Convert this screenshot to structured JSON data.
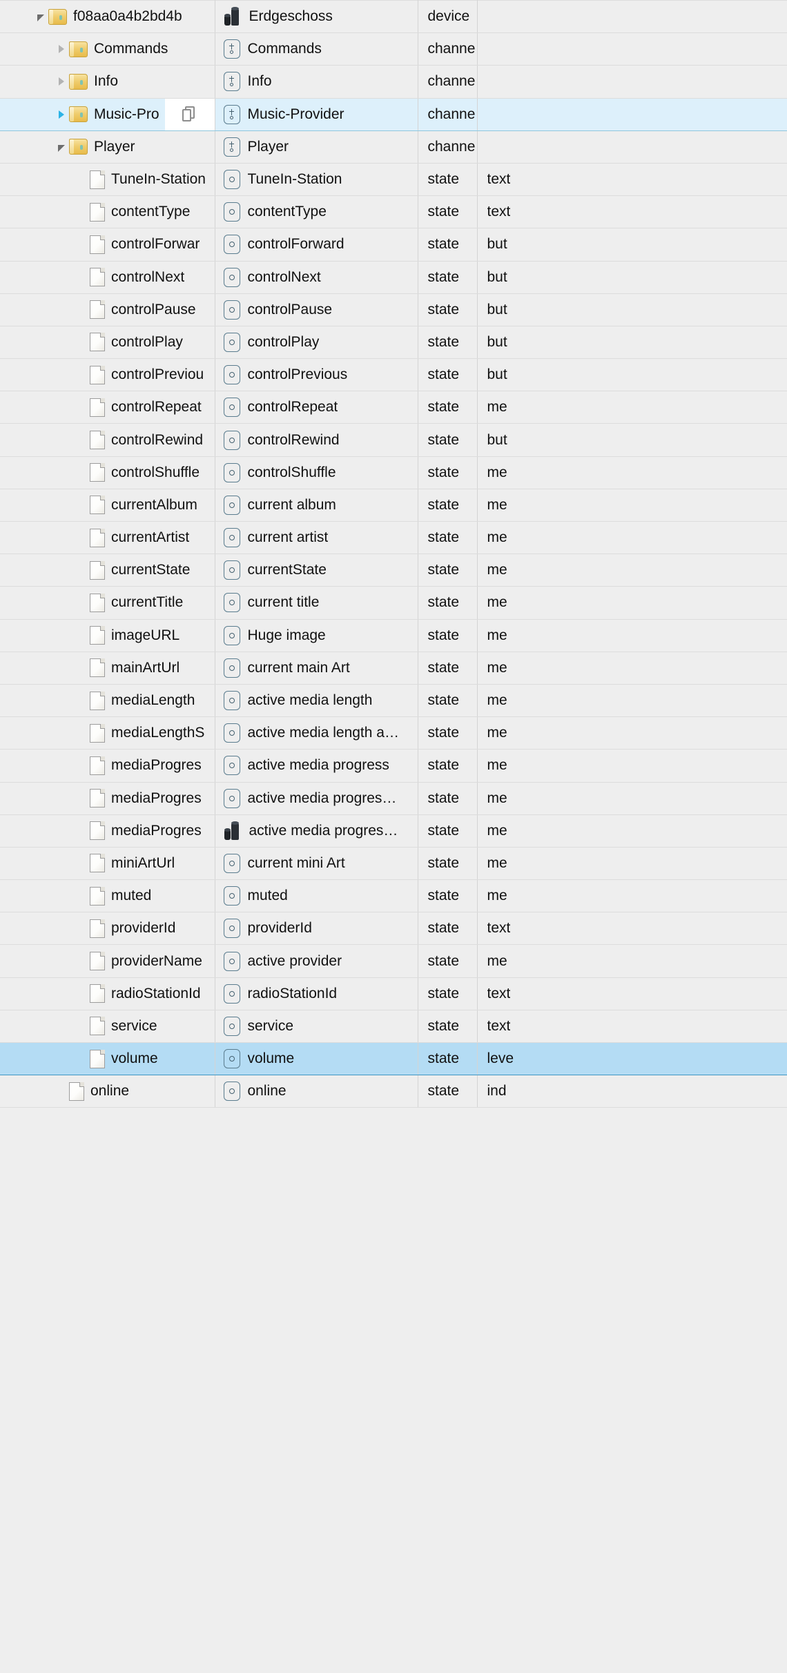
{
  "columns": [
    "name",
    "label",
    "type",
    "kind"
  ],
  "hover_action": {
    "icon": "copy-icon",
    "tooltip": "Copy"
  },
  "colors": {
    "row_background": "#eeeeee",
    "selection_light": "#ddf0fb",
    "selection_strong": "#b4dcf4",
    "selection_border": "#3f97c4",
    "grid_line": "#dcdcdc"
  },
  "rows": [
    {
      "name": "f08aa0a4b2bd4b",
      "label": "Erdgeschoss",
      "type": "device",
      "kind": "",
      "indent": 0,
      "twisty": "open",
      "icon": "folder-icon",
      "label_icon": "device-icon",
      "state": "normal"
    },
    {
      "name": "Commands",
      "label": "Commands",
      "type": "channe",
      "kind": "",
      "indent": 1,
      "twisty": "closed",
      "icon": "folder-icon",
      "label_icon": "channel-icon",
      "state": "normal"
    },
    {
      "name": "Info",
      "label": "Info",
      "type": "channe",
      "kind": "",
      "indent": 1,
      "twisty": "closed",
      "icon": "folder-icon",
      "label_icon": "channel-icon",
      "state": "normal"
    },
    {
      "name": "Music-Pro",
      "label": "Music-Provider",
      "type": "channe",
      "kind": "",
      "indent": 1,
      "twisty": "closed-blue",
      "icon": "folder-icon",
      "label_icon": "channel-icon",
      "state": "selected-light",
      "hover": true
    },
    {
      "name": "Player",
      "label": "Player",
      "type": "channe",
      "kind": "",
      "indent": 1,
      "twisty": "open",
      "icon": "folder-icon",
      "label_icon": "channel-icon",
      "state": "normal"
    },
    {
      "name": "TuneIn-Station",
      "label": "TuneIn-Station",
      "type": "state",
      "kind": "text",
      "indent": 2,
      "twisty": "none",
      "icon": "file-icon",
      "label_icon": "state-icon",
      "state": "normal"
    },
    {
      "name": "contentType",
      "label": "contentType",
      "type": "state",
      "kind": "text",
      "indent": 2,
      "twisty": "none",
      "icon": "file-icon",
      "label_icon": "state-icon",
      "state": "normal"
    },
    {
      "name": "controlForwar",
      "label": "controlForward",
      "type": "state",
      "kind": "but",
      "indent": 2,
      "twisty": "none",
      "icon": "file-icon",
      "label_icon": "state-icon",
      "state": "normal"
    },
    {
      "name": "controlNext",
      "label": "controlNext",
      "type": "state",
      "kind": "but",
      "indent": 2,
      "twisty": "none",
      "icon": "file-icon",
      "label_icon": "state-icon",
      "state": "normal"
    },
    {
      "name": "controlPause",
      "label": "controlPause",
      "type": "state",
      "kind": "but",
      "indent": 2,
      "twisty": "none",
      "icon": "file-icon",
      "label_icon": "state-icon",
      "state": "normal"
    },
    {
      "name": "controlPlay",
      "label": "controlPlay",
      "type": "state",
      "kind": "but",
      "indent": 2,
      "twisty": "none",
      "icon": "file-icon",
      "label_icon": "state-icon",
      "state": "normal"
    },
    {
      "name": "controlPreviou",
      "label": "controlPrevious",
      "type": "state",
      "kind": "but",
      "indent": 2,
      "twisty": "none",
      "icon": "file-icon",
      "label_icon": "state-icon",
      "state": "normal"
    },
    {
      "name": "controlRepeat",
      "label": "controlRepeat",
      "type": "state",
      "kind": "me",
      "indent": 2,
      "twisty": "none",
      "icon": "file-icon",
      "label_icon": "state-icon",
      "state": "normal"
    },
    {
      "name": "controlRewind",
      "label": "controlRewind",
      "type": "state",
      "kind": "but",
      "indent": 2,
      "twisty": "none",
      "icon": "file-icon",
      "label_icon": "state-icon",
      "state": "normal"
    },
    {
      "name": "controlShuffle",
      "label": "controlShuffle",
      "type": "state",
      "kind": "me",
      "indent": 2,
      "twisty": "none",
      "icon": "file-icon",
      "label_icon": "state-icon",
      "state": "normal"
    },
    {
      "name": "currentAlbum",
      "label": "current album",
      "type": "state",
      "kind": "me",
      "indent": 2,
      "twisty": "none",
      "icon": "file-icon",
      "label_icon": "state-icon",
      "state": "normal"
    },
    {
      "name": "currentArtist",
      "label": "current artist",
      "type": "state",
      "kind": "me",
      "indent": 2,
      "twisty": "none",
      "icon": "file-icon",
      "label_icon": "state-icon",
      "state": "normal"
    },
    {
      "name": "currentState",
      "label": "currentState",
      "type": "state",
      "kind": "me",
      "indent": 2,
      "twisty": "none",
      "icon": "file-icon",
      "label_icon": "state-icon",
      "state": "normal"
    },
    {
      "name": "currentTitle",
      "label": "current title",
      "type": "state",
      "kind": "me",
      "indent": 2,
      "twisty": "none",
      "icon": "file-icon",
      "label_icon": "state-icon",
      "state": "normal"
    },
    {
      "name": "imageURL",
      "label": "Huge image",
      "type": "state",
      "kind": "me",
      "indent": 2,
      "twisty": "none",
      "icon": "file-icon",
      "label_icon": "state-icon",
      "state": "normal"
    },
    {
      "name": "mainArtUrl",
      "label": "current main Art",
      "type": "state",
      "kind": "me",
      "indent": 2,
      "twisty": "none",
      "icon": "file-icon",
      "label_icon": "state-icon",
      "state": "normal"
    },
    {
      "name": "mediaLength",
      "label": "active media length",
      "type": "state",
      "kind": "me",
      "indent": 2,
      "twisty": "none",
      "icon": "file-icon",
      "label_icon": "state-icon",
      "state": "normal"
    },
    {
      "name": "mediaLengthS",
      "label": "active media length a…",
      "type": "state",
      "kind": "me",
      "indent": 2,
      "twisty": "none",
      "icon": "file-icon",
      "label_icon": "state-icon",
      "state": "normal"
    },
    {
      "name": "mediaProgres",
      "label": "active media progress",
      "type": "state",
      "kind": "me",
      "indent": 2,
      "twisty": "none",
      "icon": "file-icon",
      "label_icon": "state-icon",
      "state": "normal"
    },
    {
      "name": "mediaProgres",
      "label": "active media progres…",
      "type": "state",
      "kind": "me",
      "indent": 2,
      "twisty": "none",
      "icon": "file-icon",
      "label_icon": "state-icon",
      "state": "normal"
    },
    {
      "name": "mediaProgres",
      "label": "active media progres…",
      "type": "state",
      "kind": "me",
      "indent": 2,
      "twisty": "none",
      "icon": "file-icon",
      "label_icon": "device-icon",
      "state": "normal"
    },
    {
      "name": "miniArtUrl",
      "label": "current mini Art",
      "type": "state",
      "kind": "me",
      "indent": 2,
      "twisty": "none",
      "icon": "file-icon",
      "label_icon": "state-icon",
      "state": "normal"
    },
    {
      "name": "muted",
      "label": "muted",
      "type": "state",
      "kind": "me",
      "indent": 2,
      "twisty": "none",
      "icon": "file-icon",
      "label_icon": "state-icon",
      "state": "normal"
    },
    {
      "name": "providerId",
      "label": "providerId",
      "type": "state",
      "kind": "text",
      "indent": 2,
      "twisty": "none",
      "icon": "file-icon",
      "label_icon": "state-icon",
      "state": "normal"
    },
    {
      "name": "providerName",
      "label": "active provider",
      "type": "state",
      "kind": "me",
      "indent": 2,
      "twisty": "none",
      "icon": "file-icon",
      "label_icon": "state-icon",
      "state": "normal"
    },
    {
      "name": "radioStationId",
      "label": "radioStationId",
      "type": "state",
      "kind": "text",
      "indent": 2,
      "twisty": "none",
      "icon": "file-icon",
      "label_icon": "state-icon",
      "state": "normal"
    },
    {
      "name": "service",
      "label": "service",
      "type": "state",
      "kind": "text",
      "indent": 2,
      "twisty": "none",
      "icon": "file-icon",
      "label_icon": "state-icon",
      "state": "normal"
    },
    {
      "name": "volume",
      "label": "volume",
      "type": "state",
      "kind": "leve",
      "indent": 2,
      "twisty": "none",
      "icon": "file-icon",
      "label_icon": "state-icon",
      "state": "selected-strong"
    },
    {
      "name": "online",
      "label": "online",
      "type": "state",
      "kind": "ind",
      "indent": 1,
      "twisty": "none",
      "icon": "file-icon",
      "label_icon": "state-icon",
      "state": "normal"
    }
  ]
}
